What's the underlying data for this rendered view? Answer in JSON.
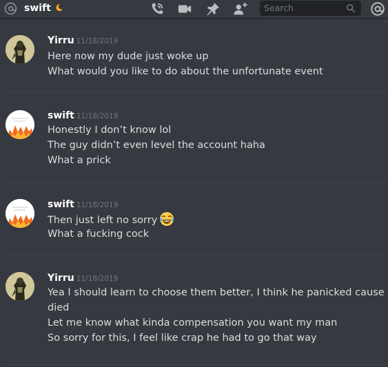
{
  "header": {
    "channel_name": "swift",
    "search_placeholder": "Search"
  },
  "messages": [
    {
      "author": "Yirru",
      "timestamp": "11/18/2019",
      "avatar": "yirru-avatar",
      "lines": [
        "Here now my dude just woke up",
        "What would you like to do about the unfortunate event"
      ]
    },
    {
      "author": "swift",
      "timestamp": "11/18/2019",
      "avatar": "swift-avatar",
      "lines": [
        "Honestly I don’t know lol",
        "The guy didn’t even level the account haha",
        "What a prick"
      ]
    },
    {
      "author": "swift",
      "timestamp": "11/18/2019",
      "avatar": "swift-avatar",
      "lines": [
        "Then just left no sorry",
        "What a fucking cock"
      ],
      "emoji": "joy-emoji"
    },
    {
      "author": "Yirru",
      "timestamp": "11/18/2019",
      "avatar": "yirru-avatar",
      "lines": [
        "Yea I should learn to choose them better, I think he panicked cause he",
        "died",
        "Let me know what kinda compensation you want my man",
        "So sorry for this, I feel like crap he had to go that way"
      ]
    }
  ],
  "icons": {
    "channel": "at-icon",
    "status": "moon-icon",
    "call": "phone-call-icon",
    "video": "video-camera-icon",
    "pin": "pin-icon",
    "add_friend": "add-user-icon",
    "search": "search-icon",
    "mentions": "mention-icon"
  },
  "colors": {
    "background": "#36393f",
    "search_bg": "#202225",
    "text": "#dcddde",
    "muted": "#72767d",
    "icon": "#b9bbbe",
    "moon": "#faa61a"
  }
}
